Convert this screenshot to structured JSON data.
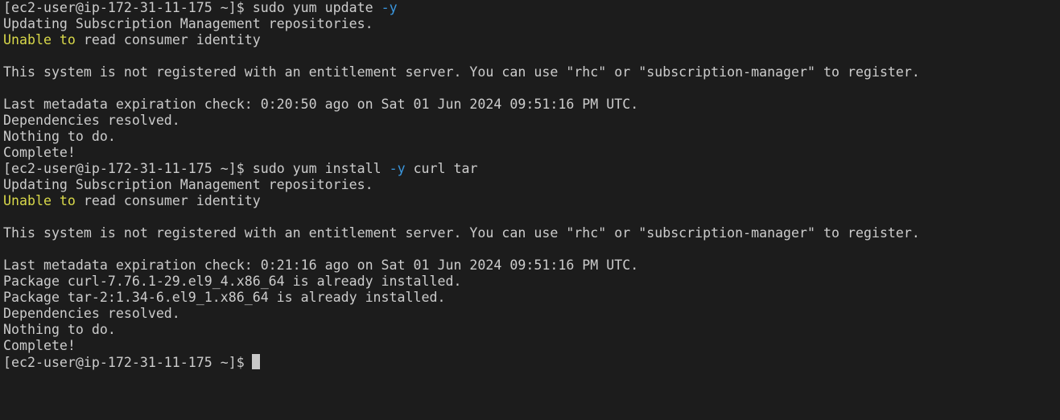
{
  "window": {
    "title": ""
  },
  "colors": {
    "background": "#1c1c1c",
    "foreground": "#cccccc",
    "flag": "#3a96dd",
    "warning": "#d8d84a",
    "cursor": "#c8c8c8"
  },
  "terminal": {
    "prompt": "[ec2-user@ip-172-31-11-175 ~]$",
    "cmd1": {
      "text": "sudo yum update",
      "flag": "-y"
    },
    "cmd2": {
      "pre": "sudo yum install",
      "flag": "-y",
      "post": "curl tar"
    },
    "updating_repos": "Updating Subscription Management repositories.",
    "unable_prefix": "Unable to",
    "unable_suffix": "read consumer identity",
    "not_registered": "This system is not registered with an entitlement server. You can use \"rhc\" or \"subscription-manager\" to register.",
    "metadata_check_1": "Last metadata expiration check: 0:20:50 ago on Sat 01 Jun 2024 09:51:16 PM UTC.",
    "metadata_check_2": "Last metadata expiration check: 0:21:16 ago on Sat 01 Jun 2024 09:51:16 PM UTC.",
    "deps_resolved": "Dependencies resolved.",
    "nothing_to_do": "Nothing to do.",
    "complete": "Complete!",
    "pkg_curl": "Package curl-7.76.1-29.el9_4.x86_64 is already installed.",
    "pkg_tar": "Package tar-2:1.34-6.el9_1.x86_64 is already installed."
  }
}
